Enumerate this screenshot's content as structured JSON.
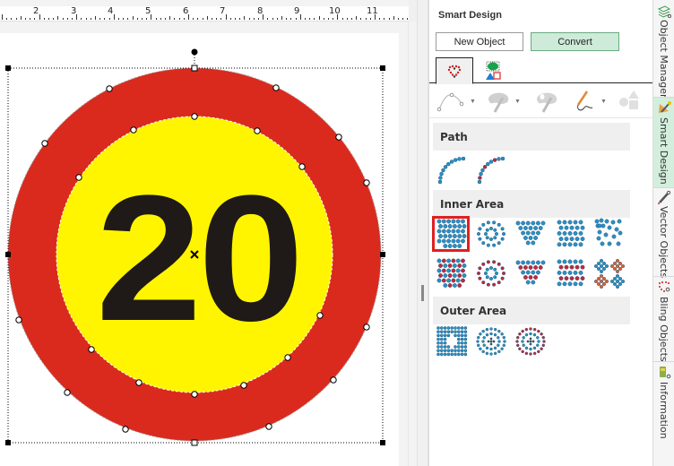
{
  "ruler": {
    "labels": [
      "2",
      "3",
      "4",
      "5",
      "6",
      "7",
      "8",
      "9",
      "10",
      "11"
    ]
  },
  "canvas": {
    "sign_text": "20",
    "colors": {
      "ring": "#da2a1e",
      "inner": "#fff500",
      "text": "#1f1a17",
      "selection": "#000000"
    }
  },
  "panel": {
    "title": "Smart Design",
    "new_object_label": "New Object",
    "convert_label": "Convert",
    "tabs": [
      {
        "icon": "bling-heart-icon",
        "active": true
      },
      {
        "icon": "shapes-icon",
        "active": false
      }
    ],
    "toolbar": [
      {
        "icon": "bezier-path-icon",
        "has_dropdown": true
      },
      {
        "icon": "palette-brush-icon",
        "has_dropdown": true
      },
      {
        "icon": "palette-eraser-icon",
        "has_dropdown": false
      },
      {
        "icon": "pencil-draw-icon",
        "has_dropdown": true
      },
      {
        "icon": "basic-shapes-icon",
        "has_dropdown": false
      }
    ],
    "sections": {
      "path": "Path",
      "inner_area": "Inner Area",
      "outer_area": "Outer Area"
    },
    "selected_item": "inner-area-fill-grid"
  },
  "vtabs": [
    {
      "label": "Object Manager",
      "icon": "layers-icon",
      "active": false
    },
    {
      "label": "Smart Design",
      "icon": "smart-design-icon",
      "active": true
    },
    {
      "label": "Vector Objects",
      "icon": "vector-pen-icon",
      "active": false
    },
    {
      "label": "Bling Objects",
      "icon": "bling-heart-icon",
      "active": false
    },
    {
      "label": "Information",
      "icon": "info-icon",
      "active": false
    }
  ],
  "colors": {
    "accent_green": "#cdebd8",
    "selected_red": "#e02020",
    "rhinestone_blue": "#2b8fc7",
    "rhinestone_red": "#c0283c"
  }
}
